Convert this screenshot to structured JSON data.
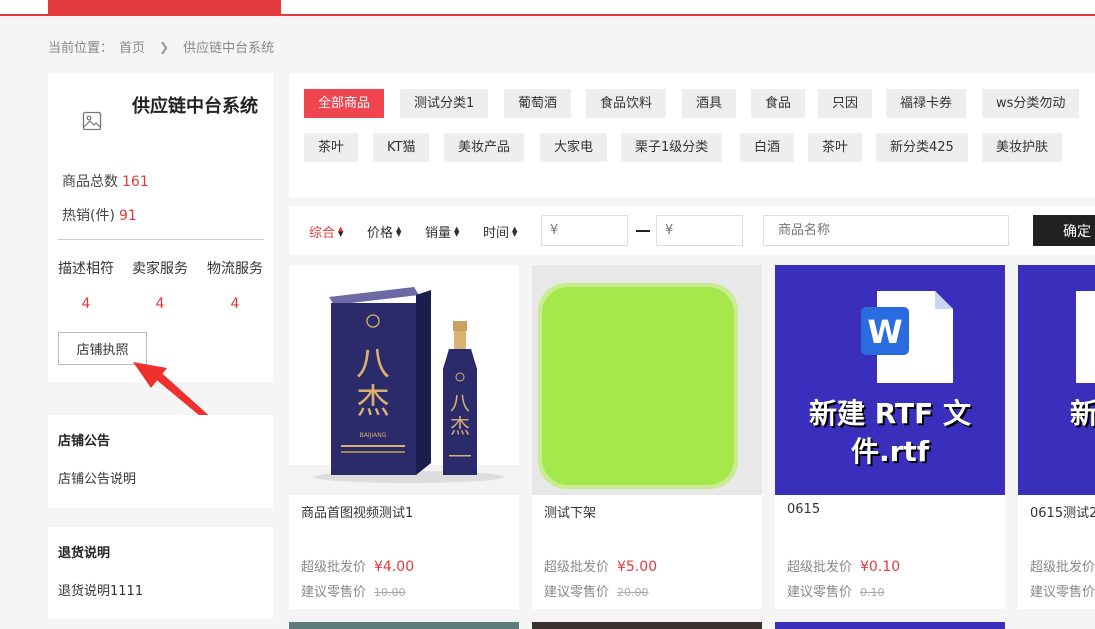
{
  "breadcrumb": {
    "label": "当前位置：",
    "home": "首页",
    "current": "供应链中台系统"
  },
  "shop": {
    "name": "供应链中台系统",
    "total_label": "商品总数",
    "total_value": "161",
    "hot_label": "热销(件)",
    "hot_value": "91",
    "ratings": [
      {
        "label": "描述相符",
        "value": "4"
      },
      {
        "label": "卖家服务",
        "value": "4"
      },
      {
        "label": "物流服务",
        "value": "4"
      }
    ],
    "license_button": "店铺执照"
  },
  "notice": {
    "title": "店铺公告",
    "text": "店铺公告说明"
  },
  "refund": {
    "title": "退货说明",
    "text": "退货说明1111"
  },
  "categories": [
    "全部商品",
    "测试分类1",
    "葡萄酒",
    "食品饮料",
    "酒具",
    "食品",
    "只因",
    "福禄卡券",
    "ws分类勿动",
    "茶叶",
    "KT猫",
    "美妆产品",
    "大家电",
    "栗子1级分类",
    "白酒",
    "茶叶",
    "新分类425",
    "美妆护肤"
  ],
  "filter": {
    "sort_items": [
      "综合",
      "价格",
      "销量",
      "时间"
    ],
    "price_min_placeholder": "¥",
    "price_max_placeholder": "¥",
    "name_placeholder": "商品名称",
    "confirm": "确定"
  },
  "products": [
    {
      "name": "商品首图视频测试1",
      "wholesale_label": "超级批发价",
      "wholesale_price": "¥4.00",
      "retail_label": "建议零售价",
      "retail_price": "10.00"
    },
    {
      "name": "测试下架",
      "wholesale_label": "超级批发价",
      "wholesale_price": "¥5.00",
      "retail_label": "建议零售价",
      "retail_price": "20.00"
    },
    {
      "name": "0615",
      "wholesale_label": "超级批发价",
      "wholesale_price": "¥0.10",
      "retail_label": "建议零售价",
      "retail_price": "0.10",
      "image_text_line1": "新建 RTF 文",
      "image_text_line2": "件.rtf"
    },
    {
      "name": "0615测试2",
      "wholesale_label": "超级批发价",
      "wholesale_price": "",
      "retail_label": "建议零售价",
      "retail_price": "",
      "image_text_line1": "新"
    }
  ],
  "liquor": {
    "brand_glyph": "八杰",
    "label_text": "BAIJIANG"
  },
  "colors": {
    "accent": "#e4393c",
    "tag_active": "#f0454f",
    "rtf_bg": "#3a2ebd",
    "green_tile": "#a4e84c"
  }
}
